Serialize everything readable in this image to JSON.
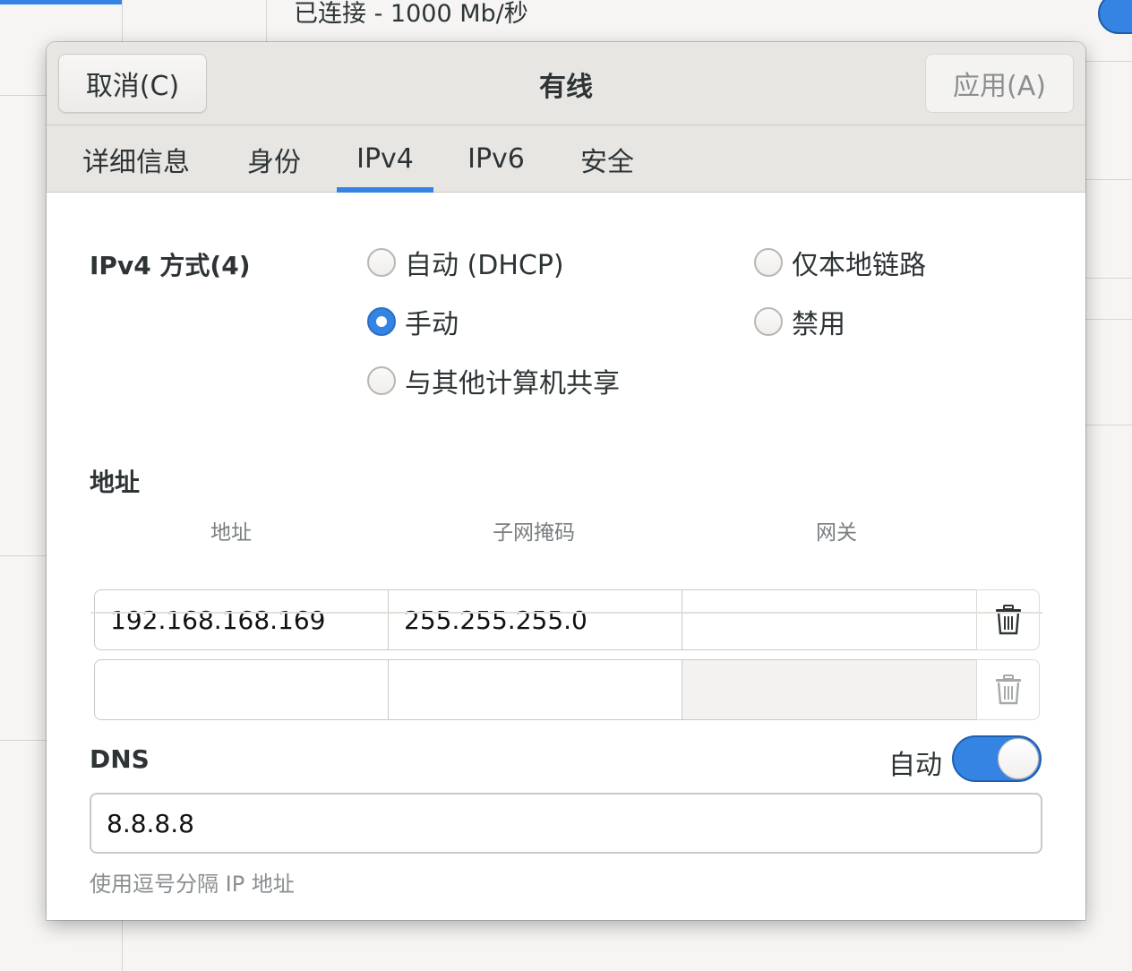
{
  "background": {
    "connection_status": "已连接 - 1000 Mb/秒"
  },
  "dialog": {
    "title": "有线",
    "cancel_label": "取消(C)",
    "apply_label": "应用(A)",
    "tabs": [
      {
        "label": "详细信息",
        "active": false
      },
      {
        "label": "身份",
        "active": false
      },
      {
        "label": "IPv4",
        "active": true
      },
      {
        "label": "IPv6",
        "active": false
      },
      {
        "label": "安全",
        "active": false
      }
    ]
  },
  "ipv4_method": {
    "label": "IPv4 方式(4)",
    "options": [
      {
        "label": "自动 (DHCP)",
        "checked": false
      },
      {
        "label": "仅本地链路",
        "checked": false
      },
      {
        "label": "手动",
        "checked": true
      },
      {
        "label": "禁用",
        "checked": false
      },
      {
        "label": "与其他计算机共享",
        "checked": false
      }
    ]
  },
  "addresses": {
    "section_label": "地址",
    "columns": [
      "地址",
      "子网掩码",
      "网关"
    ],
    "rows": [
      {
        "address": "192.168.168.169",
        "netmask": "255.255.255.0",
        "gateway": ""
      },
      {
        "address": "",
        "netmask": "",
        "gateway": ""
      }
    ]
  },
  "dns": {
    "label": "DNS",
    "auto_label": "自动",
    "auto_enabled": true,
    "value": "8.8.8.8",
    "hint": "使用逗号分隔 IP 地址"
  },
  "colors": {
    "accent": "#3584e4",
    "header_bg": "#e8e6e3"
  },
  "icons": {
    "remove_row": "trash-icon"
  }
}
